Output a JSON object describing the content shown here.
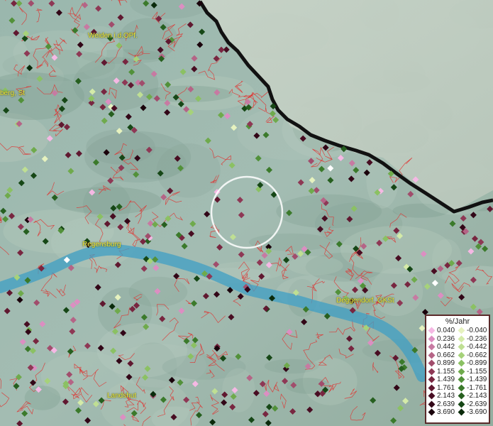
{
  "map": {
    "cities": [
      {
        "name": "Weiden i.d.OPf."
      },
      {
        "name": "berg, St"
      },
      {
        "name": "Regensburg"
      },
      {
        "name": "Deggendorf, GKSt"
      },
      {
        "name": "Landshut"
      }
    ],
    "colors": {
      "water": "#3f9fc4",
      "border_lines": "#e0302e",
      "country_border": "#111111"
    }
  },
  "legend": {
    "title": "%/Jahr",
    "rows": [
      {
        "pos": "0.040",
        "neg": "-0.040",
        "pos_color": "#f5b8e4",
        "neg_color": "#e6f2bf"
      },
      {
        "pos": "0.236",
        "neg": "-0.236",
        "pos_color": "#dc8ec2",
        "neg_color": "#d4eba8"
      },
      {
        "pos": "0.442",
        "neg": "-0.442",
        "pos_color": "#c77aa2",
        "neg_color": "#bfdf93"
      },
      {
        "pos": "0.662",
        "neg": "-0.662",
        "pos_color": "#b56486",
        "neg_color": "#a6d27a"
      },
      {
        "pos": "0.899",
        "neg": "-0.899",
        "pos_color": "#a14d6c",
        "neg_color": "#8bc163"
      },
      {
        "pos": "1.155",
        "neg": "-1.155",
        "pos_color": "#8e3855",
        "neg_color": "#6faa4c"
      },
      {
        "pos": "1.439",
        "neg": "-1.439",
        "pos_color": "#782640",
        "neg_color": "#52913a"
      },
      {
        "pos": "1.761",
        "neg": "-1.761",
        "pos_color": "#601830",
        "neg_color": "#3b7a2b"
      },
      {
        "pos": "2.143",
        "neg": "-2.143",
        "pos_color": "#480d22",
        "neg_color": "#265f1f"
      },
      {
        "pos": "2.639",
        "neg": "-2.639",
        "pos_color": "#320617",
        "neg_color": "#164716"
      },
      {
        "pos": "3.690",
        "neg": "-3.690",
        "pos_color": "#1a020b",
        "neg_color": "#0a2a0b"
      }
    ]
  }
}
